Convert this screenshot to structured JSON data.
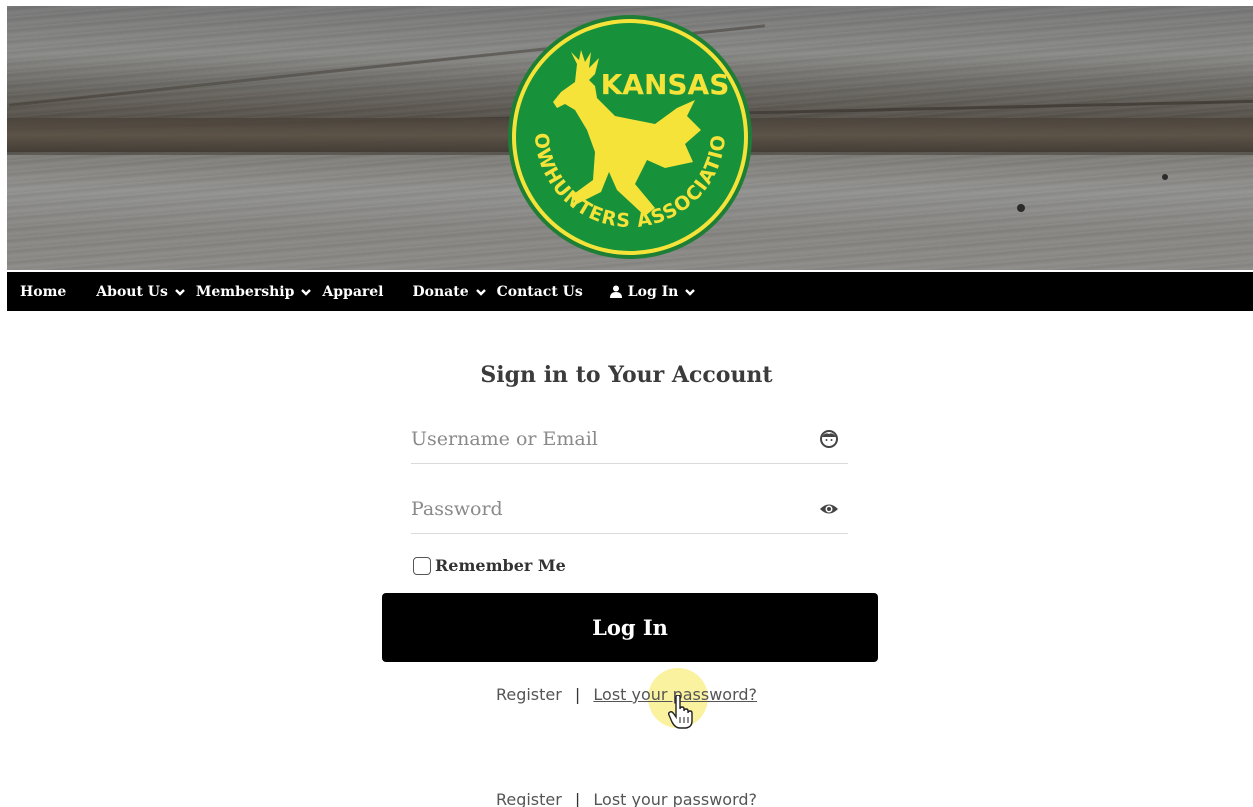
{
  "banner": {
    "logo": {
      "top_text": "KANSAS",
      "ring_text": "BOWHUNTERS ASSOCIATION",
      "colors": {
        "outer": "#1a8a34",
        "inner": "#14902f",
        "accent": "#f6e33a"
      }
    }
  },
  "nav": {
    "items": [
      {
        "label": "Home",
        "has_dropdown": false
      },
      {
        "label": "About Us",
        "has_dropdown": true
      },
      {
        "label": "Membership",
        "has_dropdown": true
      },
      {
        "label": "Apparel",
        "has_dropdown": false
      },
      {
        "label": "Donate",
        "has_dropdown": true
      },
      {
        "label": "Contact Us",
        "has_dropdown": false
      },
      {
        "label": "Log In",
        "has_dropdown": true,
        "icon": "user-icon"
      }
    ]
  },
  "form": {
    "title": "Sign in to Your Account",
    "username": {
      "placeholder": "Username or Email",
      "value": "",
      "icon": "face-icon"
    },
    "password": {
      "placeholder": "Password",
      "value": "",
      "icon": "eye-icon"
    },
    "remember_label": "Remember Me",
    "remember_checked": false,
    "submit_label": "Log In",
    "links": {
      "register": "Register",
      "separator": "|",
      "lost_password": "Lost your password?"
    }
  },
  "footer_links": {
    "register": "Register",
    "separator": "|",
    "lost_password": "Lost your password?"
  },
  "cursor": {
    "type": "pointer-hand-icon"
  }
}
